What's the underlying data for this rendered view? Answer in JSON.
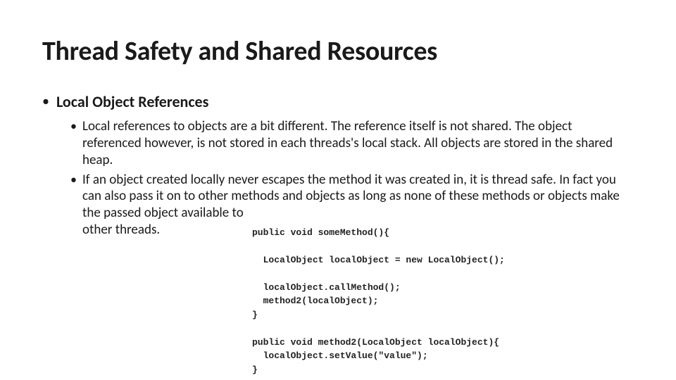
{
  "title": "Thread Safety and Shared Resources",
  "section_heading": "Local Object References",
  "bullets": {
    "b1": "Local references to objects are a bit different. The reference itself is not shared. The object referenced however, is not stored in each threads's local stack. All objects are stored in the shared heap.",
    "b2_part1": "If an object created locally never escapes the method it was created in, it is thread safe. In fact you can also pass it on to other methods and objects as long as none of these methods or objects make the passed object available to ",
    "b2_lastline": "other threads."
  },
  "code": "public void someMethod(){\n\n  LocalObject localObject = new LocalObject();\n\n  localObject.callMethod();\n  method2(localObject);\n}\n\npublic void method2(LocalObject localObject){\n  localObject.setValue(\"value\");\n}"
}
